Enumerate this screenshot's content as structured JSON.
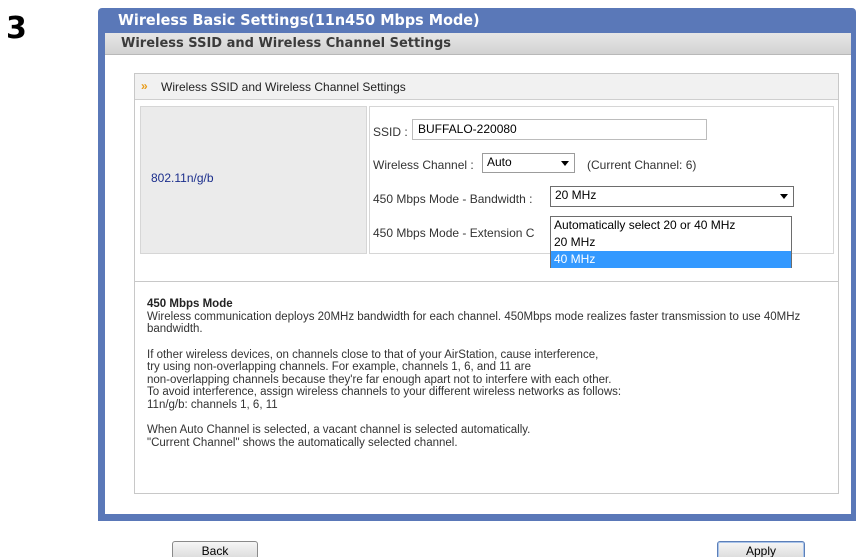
{
  "step": "3",
  "window": {
    "title": "Wireless Basic Settings(11n450 Mbps Mode)",
    "subtitle": "Wireless SSID and Wireless Channel Settings"
  },
  "section": {
    "title": "Wireless SSID and Wireless Channel Settings",
    "mode": "802.11n/g/b",
    "ssid": {
      "label": "SSID :",
      "value": "BUFFALO-220080"
    },
    "channel": {
      "label": "Wireless Channel :",
      "value": "Auto",
      "current": "(Current Channel: 6)"
    },
    "bandwidth": {
      "label": "450 Mbps Mode - Bandwidth :",
      "value": "20 MHz",
      "options": [
        "Automatically select 20 or 40 MHz",
        "20 MHz",
        "40 MHz"
      ],
      "highlighted": "40 MHz"
    },
    "extension": {
      "label": "450 Mbps Mode - Extension C"
    }
  },
  "description": {
    "heading": "450 Mbps Mode",
    "p1": "Wireless communication deploys 20MHz bandwidth for each channel. 450Mbps mode realizes faster transmission to use 40MHz bandwidth.",
    "p2_lines": [
      "If other wireless devices, on channels close to that of your AirStation, cause interference,",
      "try using non-overlapping channels. For example, channels 1, 6, and 11 are",
      "non-overlapping channels because they're far enough apart not to interfere with each other.",
      "To avoid interference, assign wireless channels to your different wireless networks as follows:",
      "11n/g/b: channels 1, 6, 11"
    ],
    "p3_lines": [
      "When Auto Channel is selected, a vacant channel is selected automatically.",
      "\"Current Channel\" shows the automatically selected channel."
    ]
  },
  "buttons": {
    "back": "Back",
    "apply": "Apply"
  },
  "colors": {
    "frame": "#5a78b8",
    "highlight": "#3399ff",
    "mode_text": "#1b2e8c"
  }
}
